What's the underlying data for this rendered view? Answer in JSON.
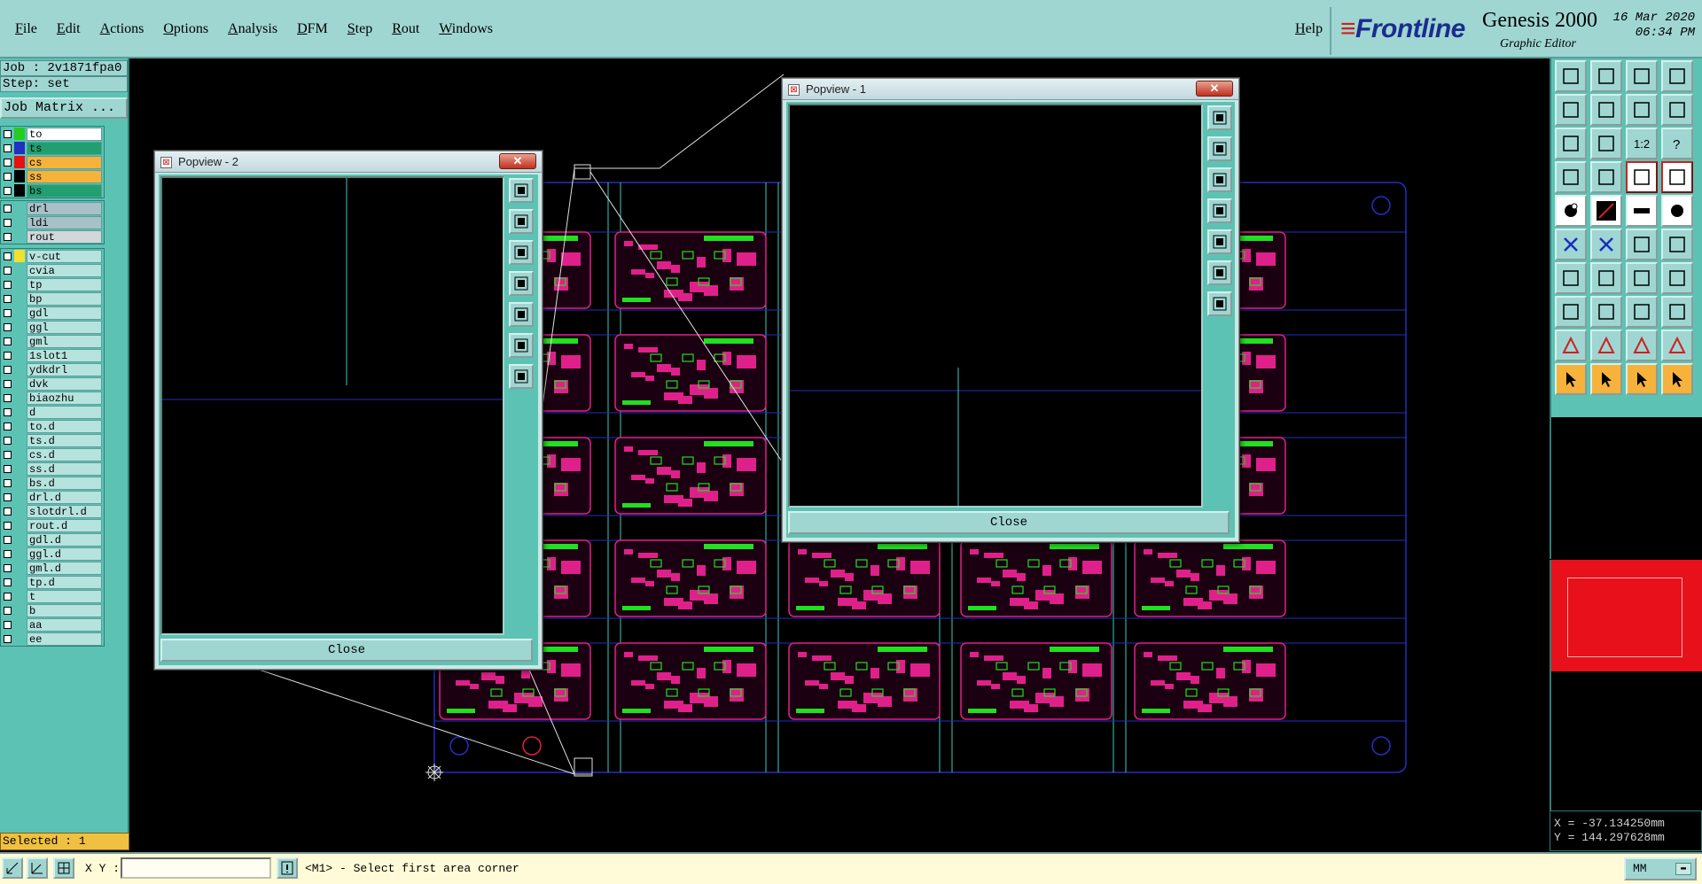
{
  "menubar": {
    "items": [
      "File",
      "Edit",
      "Actions",
      "Options",
      "Analysis",
      "DFM",
      "Step",
      "Rout",
      "Windows"
    ],
    "help": "Help",
    "brand": {
      "logo": "Frontline",
      "product": "Genesis 2000",
      "subtitle": "Graphic Editor",
      "date": "16 Mar 2020",
      "time": "06:34 PM"
    }
  },
  "job": {
    "job_label": "Job : 2v1871fpa0",
    "step_label": "Step: set",
    "matrix_button": "Job Matrix ..."
  },
  "layers": {
    "group1": [
      {
        "name": "to",
        "color": "#22cc22",
        "bg": "#ffffff"
      },
      {
        "name": "ts",
        "color": "#2030c0",
        "bg": "#20a070",
        "active": true
      },
      {
        "name": "cs",
        "color": "#e81010",
        "bg": "#f6b23a"
      },
      {
        "name": "ss",
        "color": "#000000",
        "bg": "#f6b23a"
      },
      {
        "name": "bs",
        "color": "#000000",
        "bg": "#20a070"
      }
    ],
    "group2": [
      {
        "name": "drl",
        "bg": "#a8c0c8"
      },
      {
        "name": "ldi",
        "bg": "#a8c0c8"
      },
      {
        "name": "rout",
        "bg": "#d0d8dc"
      }
    ],
    "group3": [
      {
        "name": "v-cut",
        "color": "#f0e030"
      },
      {
        "name": "cvia"
      },
      {
        "name": "tp"
      },
      {
        "name": "bp"
      },
      {
        "name": "gdl"
      },
      {
        "name": "ggl"
      },
      {
        "name": "gml"
      },
      {
        "name": "1slot1"
      },
      {
        "name": "ydkdrl"
      },
      {
        "name": "dvk"
      },
      {
        "name": "biaozhu"
      },
      {
        "name": "d"
      },
      {
        "name": "to.d"
      },
      {
        "name": "ts.d"
      },
      {
        "name": "cs.d"
      },
      {
        "name": "ss.d"
      },
      {
        "name": "bs.d"
      },
      {
        "name": "drl.d"
      },
      {
        "name": "slotdrl.d"
      },
      {
        "name": "rout.d"
      },
      {
        "name": "gdl.d"
      },
      {
        "name": "ggl.d"
      },
      {
        "name": "gml.d"
      },
      {
        "name": "tp.d"
      },
      {
        "name": "t"
      },
      {
        "name": "b"
      },
      {
        "name": "aa"
      },
      {
        "name": "ee"
      }
    ]
  },
  "selected": "Selected : 1",
  "popview2": {
    "title": "Popview - 2",
    "close_label": "Close",
    "x_label": "✕"
  },
  "popview1": {
    "title": "Popview - 1",
    "close_label": "Close",
    "x_label": "✕"
  },
  "coords": {
    "x": "X = -37.134250mm",
    "y": "Y = 144.297628mm"
  },
  "statusbar": {
    "xy_label": "X Y :",
    "xy_value": "",
    "message": "<M1> - Select first area corner",
    "units": "MM"
  },
  "colors": {
    "panel": "#5cc3b4",
    "menubar": "#9fd6d2",
    "pcb_pink": "#e0208a",
    "pcb_green": "#20e020",
    "grid_blue": "#2030c0",
    "grid_cyan": "#40c8c0"
  }
}
